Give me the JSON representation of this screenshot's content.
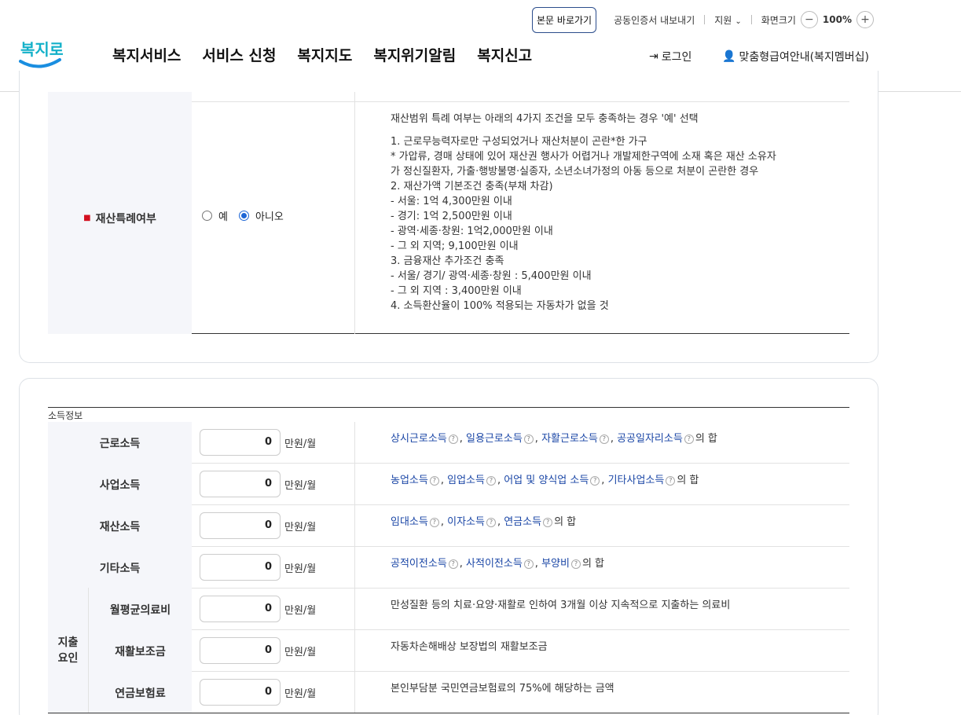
{
  "header": {
    "skip_link": "본문 바로가기",
    "cert_export": "공동인증서 내보내기",
    "support": "지원",
    "font_size_label": "화면크기",
    "zoom_level": "100%",
    "zoom_out": "−",
    "zoom_in": "+",
    "logo_text": "복지로",
    "nav": [
      "복지서비스",
      "서비스 신청",
      "복지지도",
      "복지위기알림",
      "복지신고"
    ],
    "login": "로그인",
    "membership": "맞춤형급여안내(복지멤버십)"
  },
  "property_special": {
    "label": "재산특례여부",
    "options": [
      "예",
      "아니오"
    ],
    "selected": "아니오",
    "description": [
      "재산범위 특례 여부는 아래의 4가지 조건을 모두 충족하는 경우 '예' 선택",
      "1. 근로무능력자로만 구성되었거나 재산처분이 곤란*한 가구",
      "* 가압류, 경매 상태에 있어 재산권 행사가 어렵거나 개발제한구역에 소재 혹은 재산 소유자",
      "가 정신질환자, 가출·행방불명·실종자, 소년소녀가정의 아동 등으로 처분이 곤란한 경우",
      "2. 재산가액 기본조건 충족(부채 차감)",
      "- 서울: 1억 4,300만원 이내",
      "- 경기: 1억 2,500만원 이내",
      "- 광역·세종·창원: 1억2,000만원 이내",
      "- 그 외 지역; 9,100만원 이내",
      "3. 금융재산 추가조건 충족",
      "- 서울/ 경기/ 광역·세종·창원 : 5,400만원 이내",
      "- 그 외 지역 : 3,400만원 이내",
      "4. 소득환산율이 100% 적용되는 자동차가 없을 것"
    ]
  },
  "income": {
    "caption": "소득정보",
    "unit": "만원/월",
    "help_icon": "?",
    "rows": [
      {
        "label": "근로소득",
        "value": "0",
        "links": [
          "상시근로소득",
          "일용근로소득",
          "자활근로소득",
          "공공일자리소득"
        ],
        "suffix": "의 합"
      },
      {
        "label": "사업소득",
        "value": "0",
        "links": [
          "농업소득",
          "임업소득",
          "어업 및 양식업 소득",
          "기타사업소득"
        ],
        "suffix": "의 합"
      },
      {
        "label": "재산소득",
        "value": "0",
        "links": [
          "임대소득",
          "이자소득",
          "연금소득"
        ],
        "suffix": "의 합"
      },
      {
        "label": "기타소득",
        "value": "0",
        "links": [
          "공적이전소득",
          "사적이전소득",
          "부양비"
        ],
        "suffix": "의 합"
      }
    ],
    "expense_group": "지출요인",
    "expense_rows": [
      {
        "label": "월평균의료비",
        "value": "0",
        "note": "만성질환 등의 치료·요양·재활로 인하여 3개월 이상 지속적으로 지출하는 의료비"
      },
      {
        "label": "재활보조금",
        "value": "0",
        "note": "자동차손해배상 보장법의 재활보조금"
      },
      {
        "label": "연금보험료",
        "value": "0",
        "note": "본인부담분 국민연금보험료의 75%에 해당하는 금액"
      }
    ]
  },
  "colors": {
    "brand": "#1aa3e0",
    "link": "#1a46a6",
    "required": "#d3101f",
    "radio_on": "#1e66d6"
  }
}
